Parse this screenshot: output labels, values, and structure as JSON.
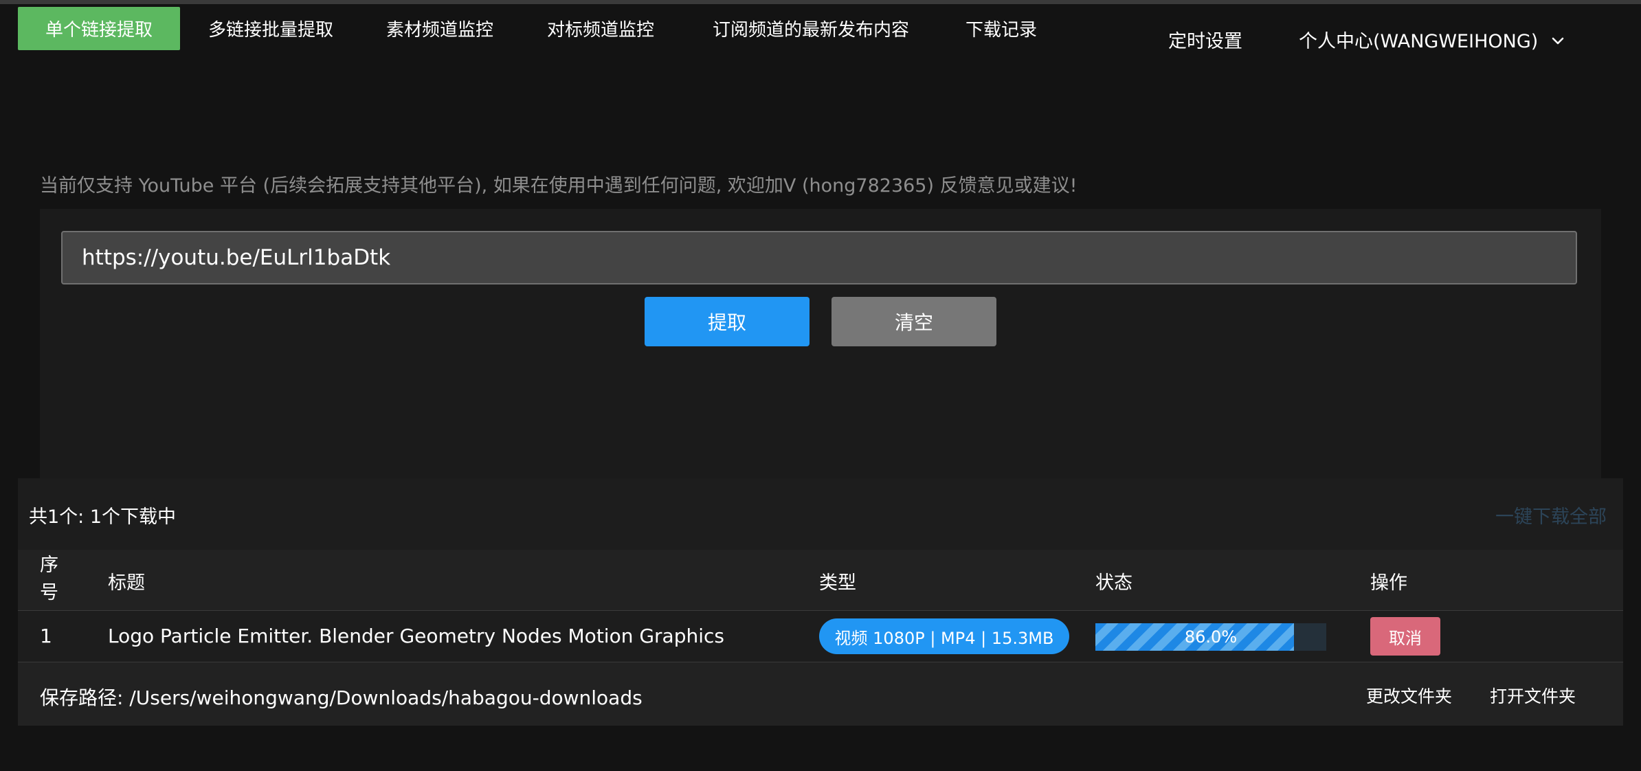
{
  "nav": {
    "tabs": [
      {
        "label": "单个链接提取",
        "active": true
      },
      {
        "label": "多链接批量提取"
      },
      {
        "label": "素材频道监控"
      },
      {
        "label": "对标频道监控"
      },
      {
        "label": "订阅频道的最新发布内容"
      },
      {
        "label": "下载记录"
      }
    ],
    "schedule": "定时设置",
    "profile": "个人中心(WANGWEIHONG)",
    "profile_icon": "chevron-down-icon"
  },
  "notice": "当前仅支持 YouTube 平台 (后续会拓展支持其他平台), 如果在使用中遇到任何问题, 欢迎加V (hong782365) 反馈意见或建议!",
  "extract": {
    "url_value": "https://youtu.be/EuLrl1baDtk",
    "extract_button": "提取",
    "clear_button": "清空"
  },
  "list": {
    "summary": "共1个: 1个下载中",
    "download_all": "一键下载全部",
    "columns": {
      "index": "序号",
      "title": "标题",
      "type": "类型",
      "status": "状态",
      "action": "操作"
    },
    "rows": [
      {
        "index": "1",
        "title": "Logo Particle Emitter. Blender Geometry Nodes Motion Graphics",
        "type": "视频 1080P | MP4 | 15.3MB",
        "progress_text": "86.0%",
        "progress": 0.86,
        "action": "取消"
      }
    ],
    "save_path": "保存路径: /Users/weihongwang/Downloads/habagou-downloads",
    "change_folder": "更改文件夹",
    "open_folder": "打开文件夹"
  },
  "colors": {
    "active_tab": "#5cb860",
    "primary": "#2196f3",
    "clear": "#777777",
    "cancel": "#d9687a"
  }
}
